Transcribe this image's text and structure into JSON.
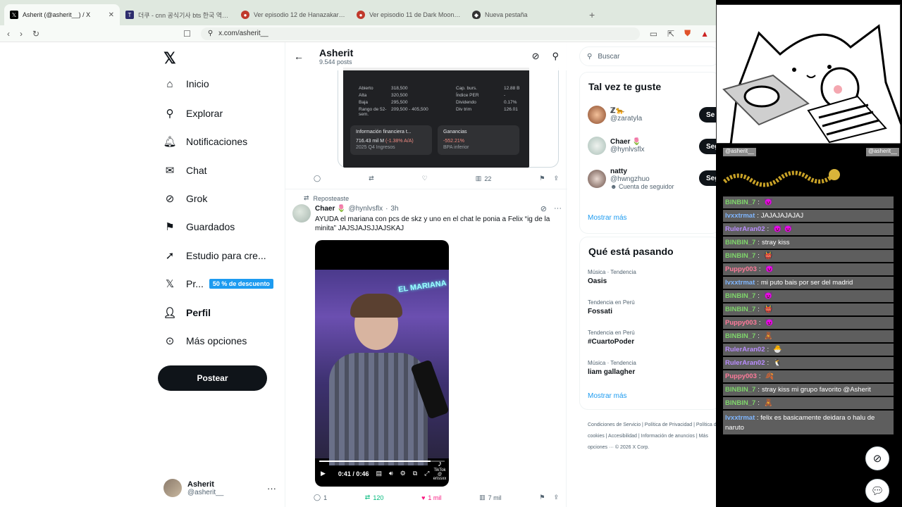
{
  "tabs": [
    {
      "label": "Asherit (@asherit__) / X",
      "icon": "x-logo",
      "color": "#000000"
    },
    {
      "label": "더쿠 - cnn 공식기사 bts 한국 역대 최",
      "icon": "T",
      "color": "#2c2c6c"
    },
    {
      "label": "Ver episodio 12 de Hanazakari no Ki",
      "icon": "anime-site",
      "color": "#c0392b"
    },
    {
      "label": "Ver episodio 11 de Dark Moon: Tsuk",
      "icon": "anime-site",
      "color": "#c0392b"
    },
    {
      "label": "Nueva pestaña",
      "icon": "shield",
      "color": "#333333"
    }
  ],
  "address": "x.com/asherit__",
  "nav": {
    "items": [
      {
        "label": "Inicio",
        "icon": "home-icon"
      },
      {
        "label": "Explorar",
        "icon": "search-icon"
      },
      {
        "label": "Notificaciones",
        "icon": "bell-icon"
      },
      {
        "label": "Chat",
        "icon": "mail-icon"
      },
      {
        "label": "Grok",
        "icon": "grok-icon"
      },
      {
        "label": "Guardados",
        "icon": "bookmark-icon"
      },
      {
        "label": "Estudio para cre...",
        "icon": "rocket-icon"
      },
      {
        "label": "Pr...",
        "icon": "x-icon"
      },
      {
        "label": "Perfil",
        "icon": "person-icon"
      },
      {
        "label": "Más opciones",
        "icon": "more-icon"
      }
    ],
    "premium_badge": "50 % de descuento",
    "post_button": "Postear",
    "account": {
      "name": "Asherit",
      "handle": "@asherit__"
    }
  },
  "profile_header": {
    "name": "Asherit",
    "posts": "9.544 posts"
  },
  "finance": {
    "rows": [
      [
        "Abierto",
        "318,500",
        "Cap. burs.",
        "12.88 B"
      ],
      [
        "Alta",
        "320,500",
        "Índice PER",
        "-"
      ],
      [
        "Baja",
        "295,500",
        "Dividendo",
        "0.17%"
      ],
      [
        "Rango de 52-sem.",
        "209,500 - 405,500",
        "Div trim",
        "126.01"
      ]
    ],
    "card1_title": "Información financiera t...",
    "card1_value": "716.43 mil M",
    "card1_change": "(-1.38% A/A)",
    "card1_sub": "2025 Q4 Ingresos",
    "card2_title": "Ganancias",
    "card2_value": "-552.21%",
    "card2_sub": "BPA inferior"
  },
  "tweet1_actions": {
    "views": "22"
  },
  "tweet2": {
    "repost_label": "Reposteaste",
    "name": "Chaer 🌷",
    "handle": "@hynlvsflx",
    "time": "3h",
    "text": "AYUDA el mariana con pcs de skz y uno en el chat le ponia a Felix “ig de la minita” JAJSJAJSJJAJSKAJ",
    "video": {
      "neon": "EL MARIANA",
      "brand": "TikTok",
      "brand_sub": "@ erissxx",
      "time": "0:41 / 0:46",
      "progress": 0.89
    },
    "replies": "1",
    "reposts": "120",
    "likes": "1 mil",
    "views": "7 mil"
  },
  "right": {
    "search_placeholder": "Buscar",
    "suggest_title": "Tal vez te guste",
    "suggestions": [
      {
        "name": "ℤ🐆",
        "handle": "@zaratyla",
        "note": ""
      },
      {
        "name": "Chaer 🌷",
        "handle": "@hynlvsflx",
        "note": ""
      },
      {
        "name": "natty",
        "handle": "@hwngzhuo",
        "note": "Cuenta de seguidor"
      }
    ],
    "follow_label": "Seguir",
    "follow_label_short": "Se",
    "show_more": "Mostrar más",
    "trends_title": "Qué está pasando",
    "trends": [
      {
        "category": "Música · Tendencia",
        "topic": "Oasis"
      },
      {
        "category": "Tendencia en Perú",
        "topic": "Fossati"
      },
      {
        "category": "Tendencia en Perú",
        "topic": "#CuartoPoder"
      },
      {
        "category": "Música · Tendencia",
        "topic": "liam gallagher"
      }
    ],
    "footer": "Condiciones de Servicio | Política de Privacidad | Política de cookies | Accesibilidad | Información de anuncios | Más opciones ··· © 2026 X Corp."
  },
  "overlay": {
    "handles": [
      "@asherit__",
      "@asherit__"
    ],
    "chat": [
      {
        "user": "BINBIN_7",
        "msg": "",
        "emote": "😈"
      },
      {
        "user": "lvxxtrmat",
        "msg": "JAJAJAJAJAJ",
        "emote": ""
      },
      {
        "user": "RulerAran02",
        "msg": "",
        "emote": "😈 😈"
      },
      {
        "user": "BINBIN_7",
        "msg": "stray kiss",
        "emote": ""
      },
      {
        "user": "BINBIN_7",
        "msg": "",
        "emote": "👹"
      },
      {
        "user": "Puppy003",
        "msg": "",
        "emote": "😈"
      },
      {
        "user": "lvxxtrmat",
        "msg": "mi puto bais por ser del madrid",
        "emote": ""
      },
      {
        "user": "BINBIN_7",
        "msg": "",
        "emote": "😈"
      },
      {
        "user": "BINBIN_7",
        "msg": "",
        "emote": "👹"
      },
      {
        "user": "Puppy003",
        "msg": "",
        "emote": "😈"
      },
      {
        "user": "BINBIN_7",
        "msg": "",
        "emote": "🧸"
      },
      {
        "user": "RulerAran02",
        "msg": "",
        "emote": "🐣"
      },
      {
        "user": "RulerAran02",
        "msg": "",
        "emote": "🐧"
      },
      {
        "user": "Puppy003",
        "msg": "",
        "emote": "🍂"
      },
      {
        "user": "BINBIN_7",
        "msg": "stray kiss mi grupo favorito @Asherit",
        "emote": ""
      },
      {
        "user": "BINBIN_7",
        "msg": "",
        "emote": "🧸"
      }
    ],
    "last_chat": {
      "user": "lvxxtrmat",
      "msg": "felix es basicamente deidara o halu de naruto"
    }
  }
}
